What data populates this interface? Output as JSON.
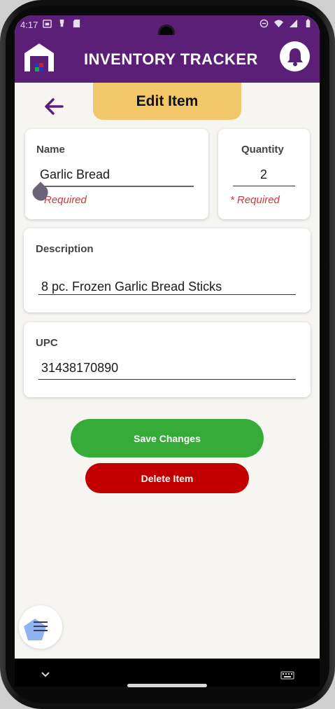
{
  "status_bar": {
    "time": "4:17",
    "left_icons": [
      "calendar-icon",
      "bulb-icon",
      "sd-card-icon"
    ],
    "right_icons": [
      "dnd-icon",
      "wifi-icon",
      "signal-icon",
      "battery-icon"
    ]
  },
  "app": {
    "title": "INVENTORY TRACKER",
    "logo_icon": "warehouse-icon",
    "notification_icon": "bell-icon"
  },
  "page": {
    "title": "Edit Item",
    "back_icon": "arrow-left-icon"
  },
  "form": {
    "name": {
      "label": "Name",
      "value": "Garlic Bread",
      "hint": "Required"
    },
    "quantity": {
      "label": "Quantity",
      "value": "2",
      "hint": "* Required"
    },
    "description": {
      "label": "Description",
      "value": "8 pc. Frozen Garlic Bread Sticks"
    },
    "upc": {
      "label": "UPC",
      "value": "31438170890"
    }
  },
  "actions": {
    "save_label": "Save Changes",
    "delete_label": "Delete Item"
  },
  "colors": {
    "header": "#5b1f77",
    "title_tab": "#f2c76a",
    "save": "#36ab38",
    "delete": "#c30000",
    "error": "#d0373c"
  }
}
